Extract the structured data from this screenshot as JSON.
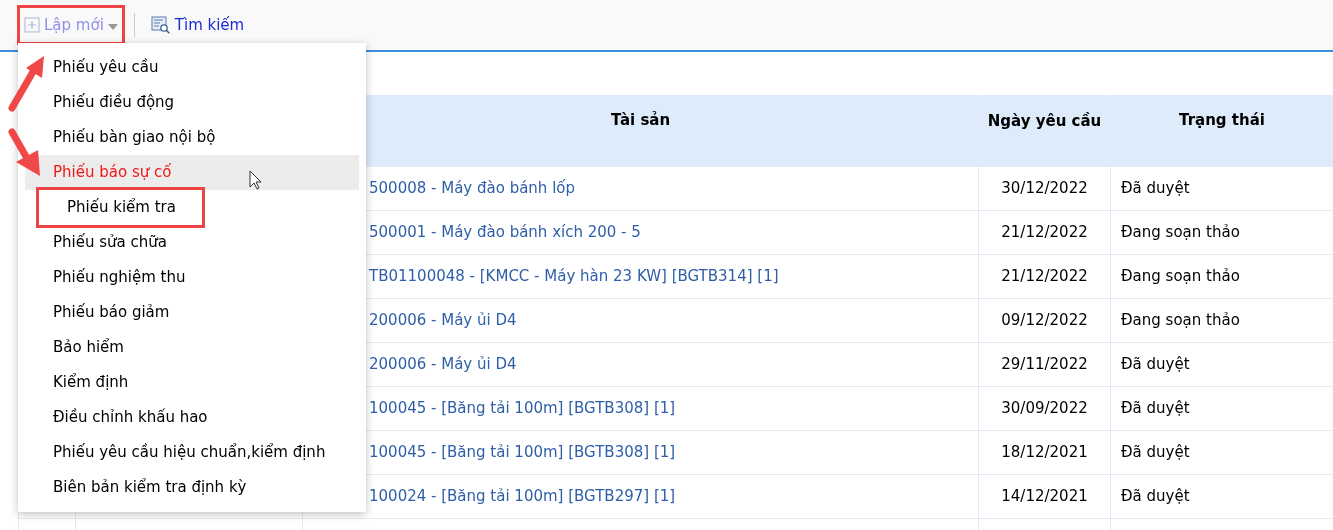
{
  "toolbar": {
    "buttons": [
      {
        "kind": "dropdown",
        "label": "Lập mới",
        "highlighted": true
      },
      {
        "kind": "search",
        "label": "Tìm kiếm",
        "highlighted": false
      }
    ]
  },
  "menu": {
    "items": [
      {
        "label": "Phiếu yêu cầu",
        "selected": false,
        "highlighted": false
      },
      {
        "label": "Phiếu điều động",
        "selected": false,
        "highlighted": false
      },
      {
        "label": "Phiếu bàn giao nội bộ",
        "selected": false,
        "highlighted": false
      },
      {
        "label": "Phiếu báo sự cố",
        "selected": true,
        "highlighted": false
      },
      {
        "label": "Phiếu kiểm tra",
        "selected": false,
        "highlighted": true
      },
      {
        "label": "Phiếu sửa chữa",
        "selected": false,
        "highlighted": false
      },
      {
        "label": "Phiếu nghiệm thu",
        "selected": false,
        "highlighted": false
      },
      {
        "label": "Phiếu báo giảm",
        "selected": false,
        "highlighted": false
      },
      {
        "label": "Bảo hiểm",
        "selected": false,
        "highlighted": false
      },
      {
        "label": "Kiểm định",
        "selected": false,
        "highlighted": false
      },
      {
        "label": "Điều chỉnh khấu hao",
        "selected": false,
        "highlighted": false
      },
      {
        "label": "Phiếu yêu cầu hiệu chuẩn,kiểm định",
        "selected": false,
        "highlighted": false
      },
      {
        "label": "Biên bản kiểm tra định kỳ",
        "selected": false,
        "highlighted": false
      }
    ]
  },
  "table": {
    "columns": [
      "Tài sản",
      "Ngày yêu cầu",
      "Trạng thái"
    ],
    "rows": [
      {
        "asset": "500008 - Máy đào bánh lốp",
        "date": "30/12/2022",
        "status": "Đã duyệt"
      },
      {
        "asset": "500001 - Máy đào bánh xích 200 - 5",
        "date": "21/12/2022",
        "status": "Đang soạn thảo"
      },
      {
        "asset": "TB01100048 - [KMCC - Máy hàn 23 KW] [BGTB314] [1]",
        "date": "21/12/2022",
        "status": "Đang soạn thảo"
      },
      {
        "asset": "200006 - Máy ủi D4",
        "date": "09/12/2022",
        "status": "Đang soạn thảo"
      },
      {
        "asset": "200006 - Máy ủi D4",
        "date": "29/11/2022",
        "status": "Đã duyệt"
      },
      {
        "asset": "100045 - [Băng tải 100m] [BGTB308] [1]",
        "date": "30/09/2022",
        "status": "Đã duyệt"
      },
      {
        "asset": "100045 - [Băng tải 100m] [BGTB308] [1]",
        "date": "18/12/2021",
        "status": "Đã duyệt"
      },
      {
        "asset": "100024 - [Băng tải 100m] [BGTB297] [1]",
        "date": "14/12/2021",
        "status": "Đã duyệt"
      }
    ]
  }
}
